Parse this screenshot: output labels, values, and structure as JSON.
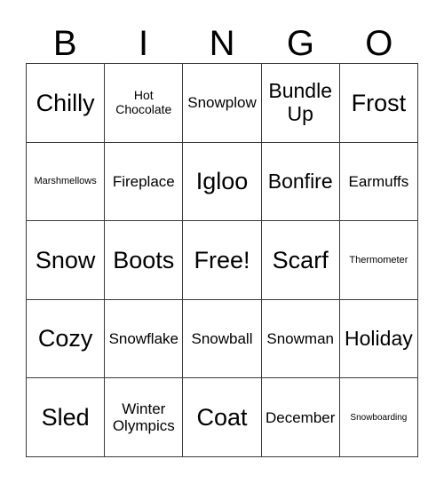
{
  "card": {
    "title": "BINGO",
    "free_space_label": "Free!",
    "header": {
      "letters": [
        "B",
        "I",
        "N",
        "G",
        "O"
      ]
    },
    "grid": {
      "rows": 5,
      "columns": 5,
      "cells": [
        [
          {
            "label": "Chilly",
            "size": "xl"
          },
          {
            "label": "Hot\nChocolate",
            "size": "sm"
          },
          {
            "label": "Snowplow",
            "size": "md"
          },
          {
            "label": "Bundle\nUp",
            "size": "lg"
          },
          {
            "label": "Frost",
            "size": "xl"
          }
        ],
        [
          {
            "label": "Marshmellows",
            "size": "xs"
          },
          {
            "label": "Fireplace",
            "size": "md"
          },
          {
            "label": "Igloo",
            "size": "xl"
          },
          {
            "label": "Bonfire",
            "size": "lg"
          },
          {
            "label": "Earmuffs",
            "size": "md"
          }
        ],
        [
          {
            "label": "Snow",
            "size": "xl"
          },
          {
            "label": "Boots",
            "size": "xl"
          },
          {
            "label": "Free!",
            "size": "xl"
          },
          {
            "label": "Scarf",
            "size": "xl"
          },
          {
            "label": "Thermometer",
            "size": "xs"
          }
        ],
        [
          {
            "label": "Cozy",
            "size": "xl"
          },
          {
            "label": "Snowflake",
            "size": "md"
          },
          {
            "label": "Snowball",
            "size": "md"
          },
          {
            "label": "Snowman",
            "size": "md"
          },
          {
            "label": "Holiday",
            "size": "lg"
          }
        ],
        [
          {
            "label": "Sled",
            "size": "xl"
          },
          {
            "label": "Winter\nOlympics",
            "size": "md"
          },
          {
            "label": "Coat",
            "size": "xl"
          },
          {
            "label": "December",
            "size": "md"
          },
          {
            "label": "Snowboarding",
            "size": "xxs"
          }
        ]
      ]
    },
    "colors": {
      "background": "#ffffff",
      "text": "#000000",
      "grid_line": "#3a3a3a"
    }
  }
}
